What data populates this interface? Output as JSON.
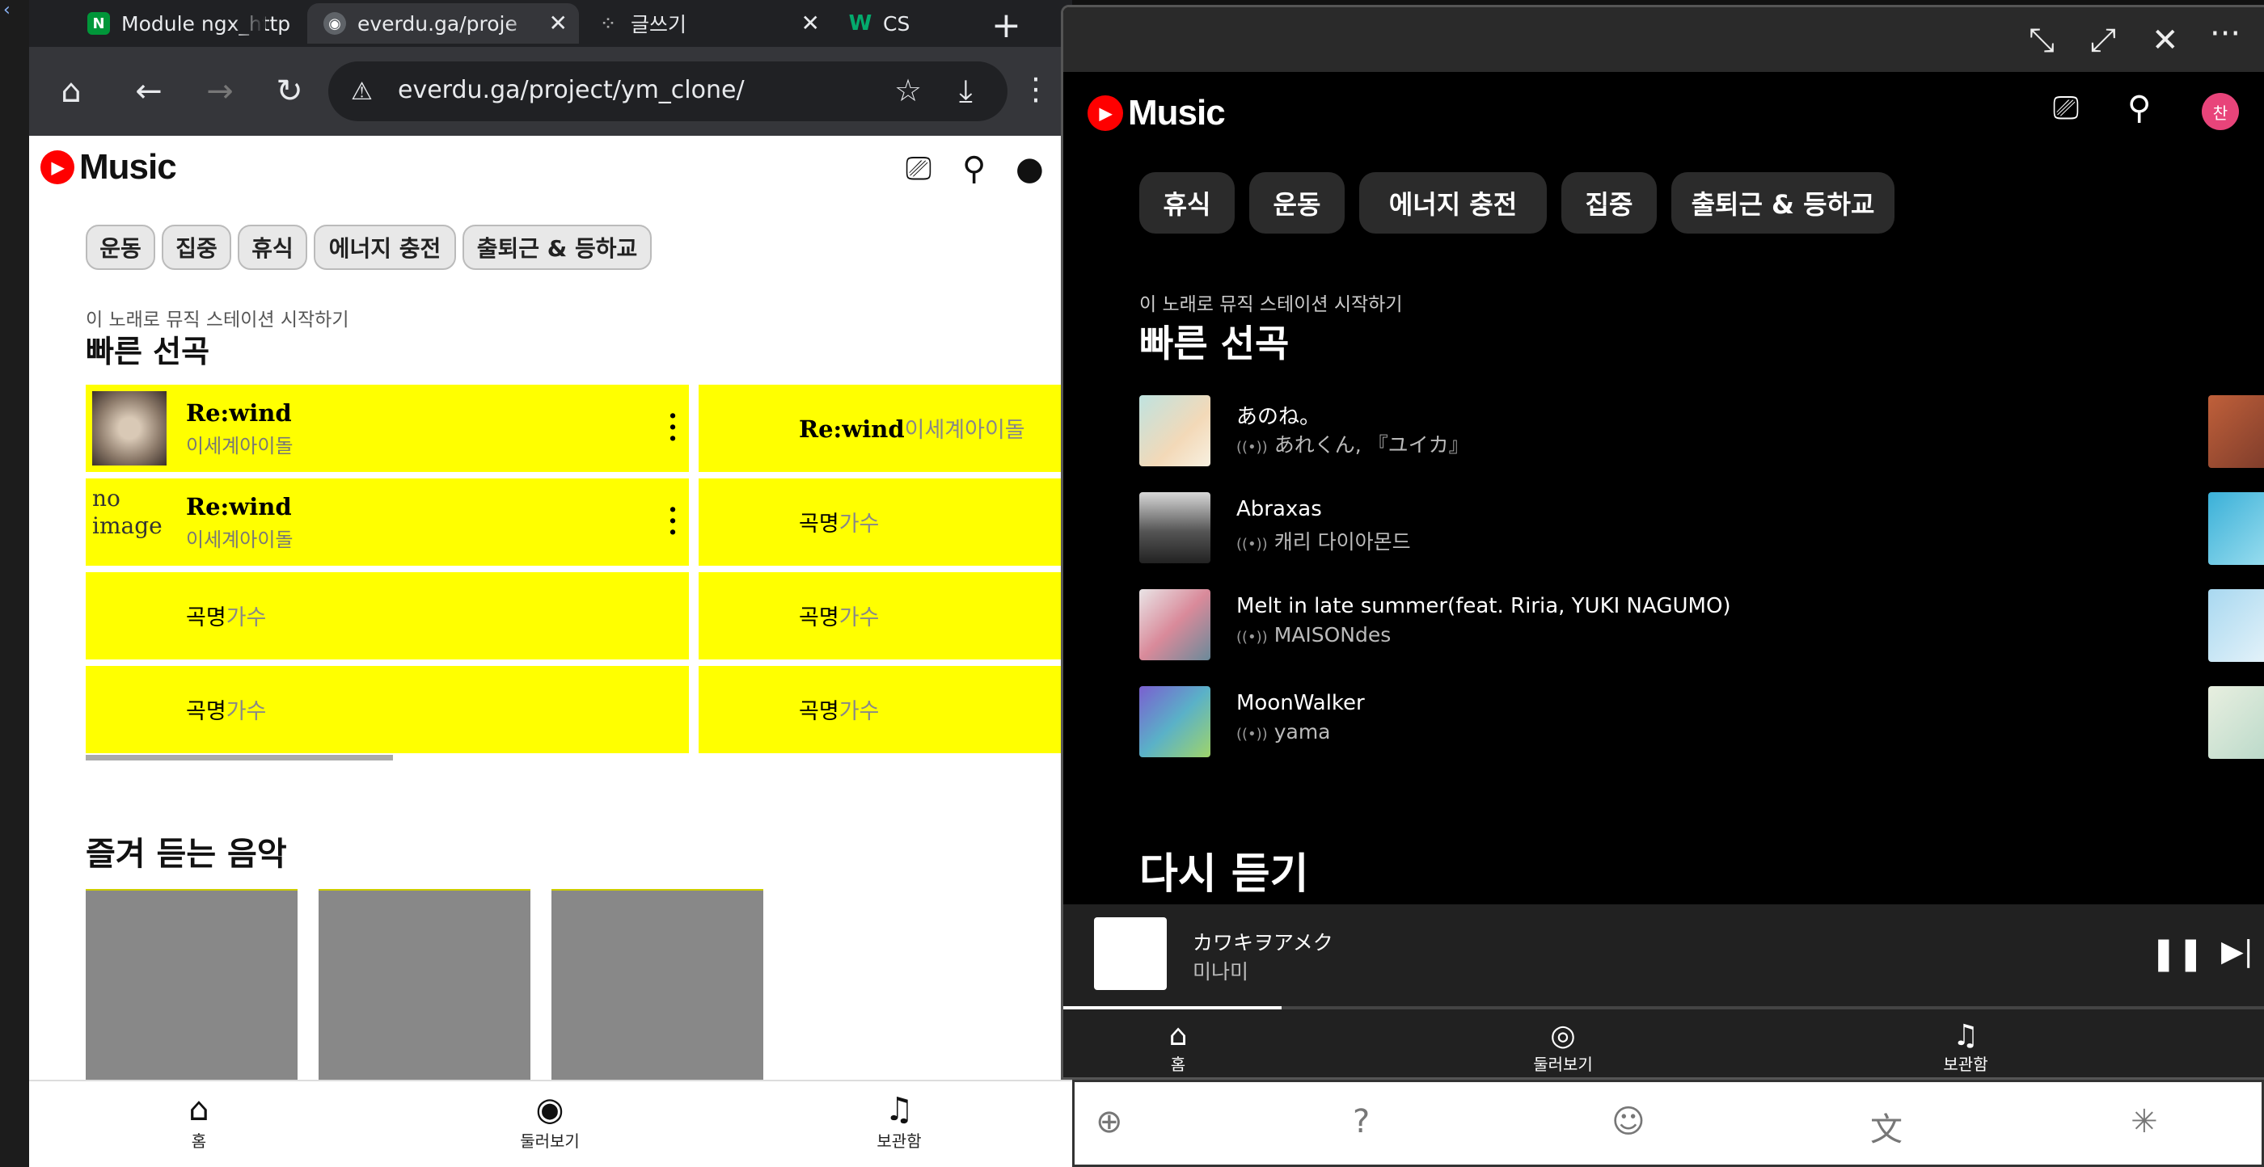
{
  "browser": {
    "tabs": [
      {
        "label": "Module ngx_http",
        "favicon": "nginx-icon",
        "color": "#009639"
      },
      {
        "label": "everdu.ga/proje",
        "favicon": "globe-icon",
        "color": "#5f6368",
        "active": true
      },
      {
        "label": "글쓰기",
        "favicon": "tistory-icon",
        "color": "#202124"
      },
      {
        "label": "CS",
        "favicon": "w3schools-icon",
        "color": "#04aa6d"
      }
    ],
    "url": "everdu.ga/project/ym_clone/"
  },
  "left_app": {
    "logo_text": "Music",
    "chips": [
      "운동",
      "집중",
      "휴식",
      "에너지 충전",
      "출퇴근 & 등하교"
    ],
    "quick_subtitle": "이 노래로 뮤직 스테이션 시작하기",
    "quick_title": "빠른 선곡",
    "quick_cells": [
      {
        "title": "Re:wind",
        "artist": "이세계아이돌"
      },
      {
        "title": "Re:wind",
        "artist": "이세계아이돌"
      },
      {
        "title": "Re:wind",
        "artist": "이세계아이돌",
        "alt": "no image"
      },
      {
        "title": "곡명",
        "artist": "가수"
      },
      {
        "title": "곡명",
        "artist": "가수"
      },
      {
        "title": "곡명",
        "artist": "가수"
      },
      {
        "title": "곡명",
        "artist": "가수"
      },
      {
        "title": "곡명",
        "artist": "가수"
      }
    ],
    "favorites_title": "즐겨 듣는 음악",
    "nav": [
      "홈",
      "둘러보기",
      "보관함"
    ]
  },
  "right_app": {
    "logo_text": "Music",
    "avatar_initial": "찬",
    "chips": [
      "휴식",
      "운동",
      "에너지 충전",
      "집중",
      "출퇴근 & 등하교"
    ],
    "quick_subtitle": "이 노래로 뮤직 스테이션 시작하기",
    "quick_title": "빠른 선곡",
    "tracks": [
      {
        "title": "あのね。",
        "artist": "あれくん, 『ユイカ』"
      },
      {
        "title": "Abraxas",
        "artist": "캐리 다이아몬드"
      },
      {
        "title": "Melt in late summer(feat. Riria, YUKI NAGUMO)",
        "artist": "MAISONdes"
      },
      {
        "title": "MoonWalker",
        "artist": "yama"
      }
    ],
    "again_title": "다시 듣기",
    "now_playing": {
      "title": "カワキヲアメク",
      "artist": "미나미",
      "progress": 0.18
    },
    "nav": [
      "홈",
      "둘러보기",
      "보관함"
    ]
  }
}
